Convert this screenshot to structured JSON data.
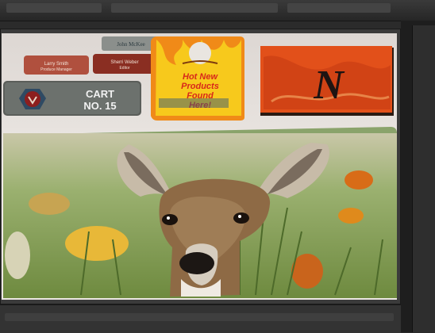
{
  "window": {
    "title": ""
  },
  "photo": {
    "subject": "deer-photo-panel",
    "items": {
      "name_badge_1": "Larry Smith",
      "name_badge_1_sub": "Produce Manager",
      "name_badge_2": "Sherri Weber",
      "name_badge_2_sub": "Editor",
      "name_badge_3": "John McKee",
      "cart_sign": "CART NO. 15",
      "door_hanger": "Hot New Products Found Here!",
      "letter_tile": "N"
    }
  },
  "colors": {
    "chrome": "#2b2b2b",
    "panel_bg": "#3b3b3b",
    "sign_orange": "#e2501a",
    "flame_yellow": "#f5c21c"
  }
}
